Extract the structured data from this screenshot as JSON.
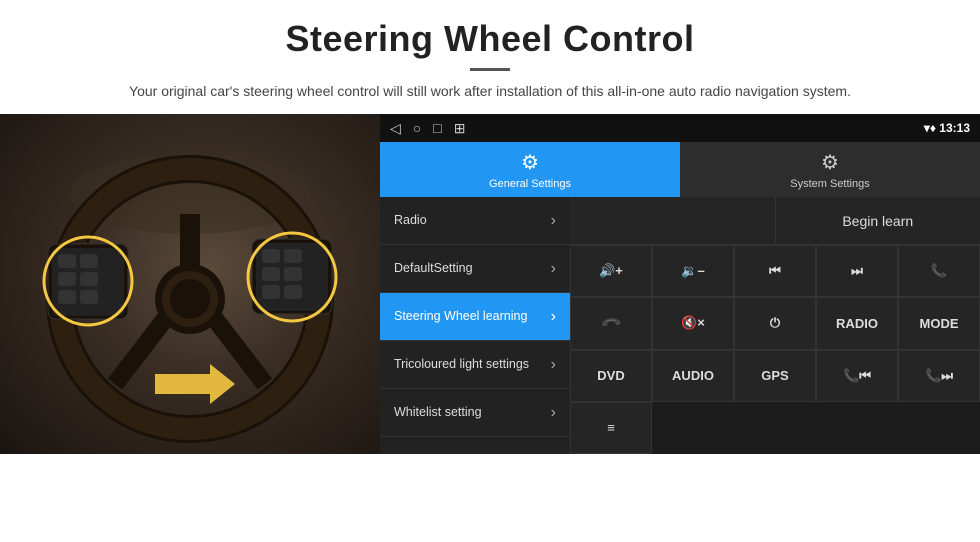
{
  "header": {
    "title": "Steering Wheel Control",
    "subtitle": "Your original car's steering wheel control will still work after installation of this all-in-one auto radio navigation system."
  },
  "status_bar": {
    "nav_back": "◁",
    "nav_home": "○",
    "nav_recent": "□",
    "nav_menu": "⊞",
    "time": "13:13",
    "wifi": "▾",
    "signal": "▾"
  },
  "tabs": [
    {
      "id": "general",
      "label": "General Settings",
      "icon": "⚙",
      "active": true
    },
    {
      "id": "system",
      "label": "System Settings",
      "icon": "⚙",
      "active": false
    }
  ],
  "menu_items": [
    {
      "id": "radio",
      "label": "Radio",
      "active": false
    },
    {
      "id": "default-setting",
      "label": "DefaultSetting",
      "active": false
    },
    {
      "id": "steering-wheel",
      "label": "Steering Wheel learning",
      "active": true
    },
    {
      "id": "tricoloured",
      "label": "Tricoloured light settings",
      "active": false
    },
    {
      "id": "whitelist",
      "label": "Whitelist setting",
      "active": false
    }
  ],
  "controls": {
    "begin_learn": "Begin learn",
    "buttons": [
      {
        "id": "vol-up",
        "label": "🔊+",
        "unicode": "vol+"
      },
      {
        "id": "vol-down",
        "label": "🔉-",
        "unicode": "vol-"
      },
      {
        "id": "prev-track",
        "label": "|◀◀",
        "unicode": "prev"
      },
      {
        "id": "next-track",
        "label": "▶▶|",
        "unicode": "next"
      },
      {
        "id": "phone",
        "label": "☎",
        "unicode": "phone"
      },
      {
        "id": "hang-up",
        "label": "↩",
        "unicode": "hangup"
      },
      {
        "id": "mute",
        "label": "🔇×",
        "unicode": "mute"
      },
      {
        "id": "power",
        "label": "⏻",
        "unicode": "power"
      },
      {
        "id": "radio-btn",
        "label": "RADIO",
        "unicode": "radio"
      },
      {
        "id": "mode-btn",
        "label": "MODE",
        "unicode": "mode"
      },
      {
        "id": "dvd-btn",
        "label": "DVD",
        "unicode": "dvd"
      },
      {
        "id": "audio-btn",
        "label": "AUDIO",
        "unicode": "audio"
      },
      {
        "id": "gps-btn",
        "label": "GPS",
        "unicode": "gps"
      },
      {
        "id": "phone-prev",
        "label": "📞|◀◀",
        "unicode": "phone-prev"
      },
      {
        "id": "phone-next",
        "label": "📞▶▶|",
        "unicode": "phone-next"
      },
      {
        "id": "menu-btn",
        "label": "≡",
        "unicode": "menu"
      }
    ]
  },
  "colors": {
    "active_blue": "#2196F3",
    "dark_bg": "#1a1a1a",
    "panel_bg": "#252525",
    "border": "#333333"
  }
}
